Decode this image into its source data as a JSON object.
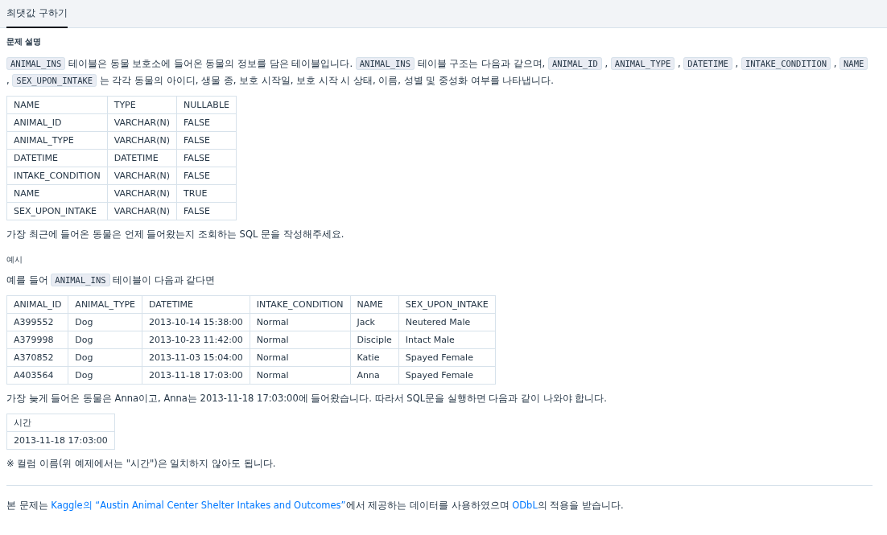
{
  "tabs": [
    {
      "label": "최댓값 구하기",
      "selected": true
    }
  ],
  "section_title": "문제 설명",
  "description": [
    {
      "kind": "code",
      "text": "ANIMAL_INS"
    },
    {
      "kind": "text",
      "text": " 테이블은 동물 보호소에 들어온 동물의 정보를 담은 테이블입니다. "
    },
    {
      "kind": "code",
      "text": "ANIMAL_INS"
    },
    {
      "kind": "text",
      "text": " 테이블 구조는 다음과 같으며, "
    },
    {
      "kind": "code",
      "text": "ANIMAL_ID"
    },
    {
      "kind": "text",
      "text": " , "
    },
    {
      "kind": "code",
      "text": "ANIMAL_TYPE"
    },
    {
      "kind": "text",
      "text": " , "
    },
    {
      "kind": "code",
      "text": "DATETIME"
    },
    {
      "kind": "text",
      "text": " , "
    },
    {
      "kind": "code",
      "text": "INTAKE_CONDITION"
    },
    {
      "kind": "text",
      "text": " , "
    },
    {
      "kind": "code",
      "text": "NAME"
    },
    {
      "kind": "text",
      "text": " , "
    },
    {
      "kind": "code",
      "text": "SEX_UPON_INTAKE"
    },
    {
      "kind": "text",
      "text": " 는 각각 동물의 아이디, 생물 종, 보호 시작일, 보호 시작 시 상태, 이름, 성별 및 중성화 여부를 나타냅니다."
    }
  ],
  "schema_table": {
    "columns": [
      "NAME",
      "TYPE",
      "NULLABLE"
    ],
    "rows": [
      [
        "ANIMAL_ID",
        "VARCHAR(N)",
        "FALSE"
      ],
      [
        "ANIMAL_TYPE",
        "VARCHAR(N)",
        "FALSE"
      ],
      [
        "DATETIME",
        "DATETIME",
        "FALSE"
      ],
      [
        "INTAKE_CONDITION",
        "VARCHAR(N)",
        "FALSE"
      ],
      [
        "NAME",
        "VARCHAR(N)",
        "TRUE"
      ],
      [
        "SEX_UPON_INTAKE",
        "VARCHAR(N)",
        "FALSE"
      ]
    ]
  },
  "question": "가장 최근에 들어온 동물은 언제 들어왔는지 조회하는 SQL 문을 작성해주세요.",
  "example_title": "예시",
  "example_intro": [
    {
      "kind": "text",
      "text": "예를 들어 "
    },
    {
      "kind": "code",
      "text": "ANIMAL_INS"
    },
    {
      "kind": "text",
      "text": " 테이블이 다음과 같다면"
    }
  ],
  "example_table": {
    "columns": [
      "ANIMAL_ID",
      "ANIMAL_TYPE",
      "DATETIME",
      "INTAKE_CONDITION",
      "NAME",
      "SEX_UPON_INTAKE"
    ],
    "rows": [
      [
        "A399552",
        "Dog",
        "2013-10-14 15:38:00",
        "Normal",
        "Jack",
        "Neutered Male"
      ],
      [
        "A379998",
        "Dog",
        "2013-10-23 11:42:00",
        "Normal",
        "Disciple",
        "Intact Male"
      ],
      [
        "A370852",
        "Dog",
        "2013-11-03 15:04:00",
        "Normal",
        "Katie",
        "Spayed Female"
      ],
      [
        "A403564",
        "Dog",
        "2013-11-18 17:03:00",
        "Normal",
        "Anna",
        "Spayed Female"
      ]
    ]
  },
  "explanation": "가장 늦게 들어온 동물은 Anna이고, Anna는 2013-11-18 17:03:00에 들어왔습니다. 따라서 SQL문을 실행하면 다음과 같이 나와야 합니다.",
  "result_table": {
    "columns": [
      "시간"
    ],
    "rows": [
      [
        "2013-11-18 17:03:00"
      ]
    ]
  },
  "note": "※ 컬럼 이름(위 예제에서는 \"시간\")은 일치하지 않아도 됩니다.",
  "footer": [
    {
      "kind": "text",
      "text": "본 문제는 "
    },
    {
      "kind": "link",
      "text": "Kaggle의 “Austin Animal Center Shelter Intakes and Outcomes”"
    },
    {
      "kind": "text",
      "text": "에서 제공하는 데이터를 사용하였으며 "
    },
    {
      "kind": "link",
      "text": "ODbL"
    },
    {
      "kind": "text",
      "text": "의 적용을 받습니다."
    }
  ]
}
